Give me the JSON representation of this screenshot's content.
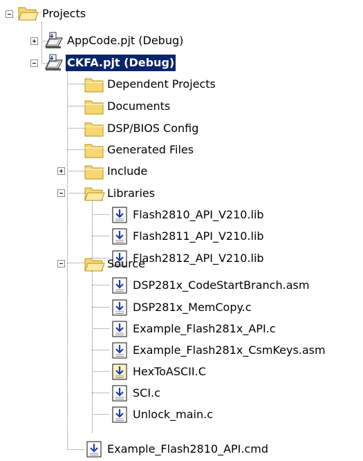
{
  "tree": {
    "root": {
      "label": "Projects",
      "icon": "open-folder-icon"
    },
    "projects": [
      {
        "label": "AppCode.pjt (Debug)",
        "icon": "project-file-icon"
      },
      {
        "label": "CKFA.pjt (Debug)",
        "icon": "project-file-icon"
      }
    ],
    "ckfa_children": [
      {
        "label": "Dependent Projects",
        "icon": "folder-icon"
      },
      {
        "label": "Documents",
        "icon": "folder-icon"
      },
      {
        "label": "DSP/BIOS Config",
        "icon": "folder-icon"
      },
      {
        "label": "Generated Files",
        "icon": "folder-icon"
      },
      {
        "label": "Include",
        "icon": "folder-icon"
      },
      {
        "label": "Libraries",
        "icon": "open-folder-icon"
      },
      {
        "label": "Source",
        "icon": "open-folder-icon"
      }
    ],
    "libraries": [
      {
        "label": "Flash2810_API_V210.lib",
        "icon": "file-icon"
      },
      {
        "label": "Flash2811_API_V210.lib",
        "icon": "file-icon"
      },
      {
        "label": "Flash2812_API_V210.lib",
        "icon": "file-icon"
      }
    ],
    "source": [
      {
        "label": "DSP281x_CodeStartBranch.asm",
        "icon": "file-icon"
      },
      {
        "label": "DSP281x_MemCopy.c",
        "icon": "file-icon"
      },
      {
        "label": "Example_Flash281x_API.c",
        "icon": "file-icon"
      },
      {
        "label": "Example_Flash281x_CsmKeys.asm",
        "icon": "file-icon"
      },
      {
        "label": "HexToASCII.C",
        "icon": "file-icon"
      },
      {
        "label": "SCI.c",
        "icon": "file-icon"
      },
      {
        "label": "Unlock_main.c",
        "icon": "file-icon"
      }
    ],
    "cmd_file": {
      "label": "Example_Flash2810_API.cmd",
      "icon": "file-icon"
    }
  },
  "colors": {
    "selection": "#0a246a",
    "folder": "#f7d774",
    "folder_dark": "#b8900f",
    "file_arrow": "#1f3ea8"
  }
}
